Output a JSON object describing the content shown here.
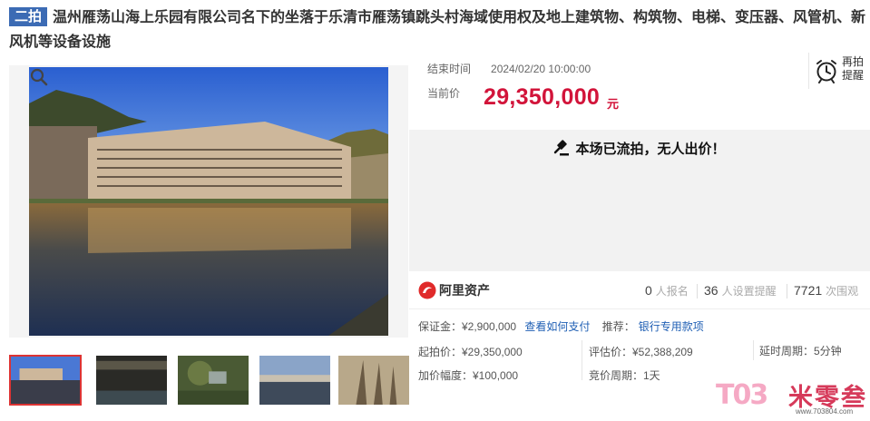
{
  "title": {
    "badge": "二拍",
    "text": "温州雁荡山海上乐园有限公司名下的坐落于乐清市雁荡镇跳头村海域使用权及地上建筑物、构筑物、电梯、变压器、风管机、新风机等设备设施"
  },
  "auction": {
    "end_label": "结束时间",
    "end_time": "2024/02/20 10:00:00",
    "price_label": "当前价",
    "price": "29,350,000",
    "price_unit": "元",
    "reminder_line1": "再拍",
    "reminder_line2": "提醒",
    "status": "本场已流拍，无人出价！"
  },
  "stats": {
    "brand": "阿里资产",
    "signups": "0",
    "signups_label": "人报名",
    "reminders": "36",
    "reminders_label": "人设置提醒",
    "views": "7721",
    "views_label": "次围观"
  },
  "details": {
    "deposit": "保证金：¥2,900,000",
    "how_to_pay": "查看如何支付",
    "recommend_label": "推荐：",
    "recommend_link": "银行专用款项",
    "start_price": "起拍价：¥29,350,000",
    "appraisal": "评估价：¥52,388,209",
    "delay": "延时周期：5分钟",
    "increment": "加价幅度：¥100,000",
    "bid_cycle": "竞价周期：1天"
  },
  "watermark": {
    "logo": "T03",
    "name": "米零叁",
    "url": "www.703804.com"
  },
  "colors": {
    "accent_red": "#d2143a",
    "link_blue": "#1f5fb4",
    "badge_blue": "#3c6bb4"
  }
}
